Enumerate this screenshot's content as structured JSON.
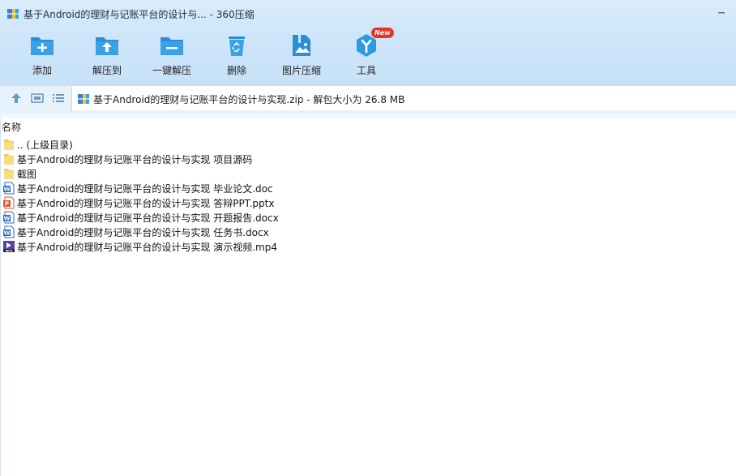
{
  "window": {
    "title": "基于Android的理财与记账平台的设计与... - 360压缩"
  },
  "toolbar": {
    "items": [
      {
        "label": "添加",
        "icon": "folder-add-icon"
      },
      {
        "label": "解压到",
        "icon": "folder-extract-icon"
      },
      {
        "label": "一键解压",
        "icon": "folder-oneclick-icon"
      },
      {
        "label": "删除",
        "icon": "recycle-bin-icon"
      },
      {
        "label": "图片压缩",
        "icon": "image-compress-icon"
      },
      {
        "label": "工具",
        "icon": "tools-icon",
        "badge": "New"
      }
    ]
  },
  "address": {
    "text": "基于Android的理财与记账平台的设计与实现.zip - 解包大小为 26.8 MB"
  },
  "list": {
    "column_name": "名称",
    "rows": [
      {
        "name": ".. (上级目录)",
        "type": "folder"
      },
      {
        "name": "基于Android的理财与记账平台的设计与实现 项目源码",
        "type": "folder"
      },
      {
        "name": "截图",
        "type": "folder"
      },
      {
        "name": "基于Android的理财与记账平台的设计与实现 毕业论文.doc",
        "type": "word"
      },
      {
        "name": "基于Android的理财与记账平台的设计与实现 答辩PPT.pptx",
        "type": "ppt"
      },
      {
        "name": "基于Android的理财与记账平台的设计与实现 开题报告.docx",
        "type": "word"
      },
      {
        "name": "基于Android的理财与记账平台的设计与实现 任务书.docx",
        "type": "word"
      },
      {
        "name": "基于Android的理财与记账平台的设计与实现 演示视频.mp4",
        "type": "video"
      }
    ]
  },
  "colors": {
    "toolbar_bg": "#cfe6fa",
    "icon_blue": "#2a8fd8",
    "badge_red": "#e8332a",
    "folder_yellow": "#f7d674"
  }
}
